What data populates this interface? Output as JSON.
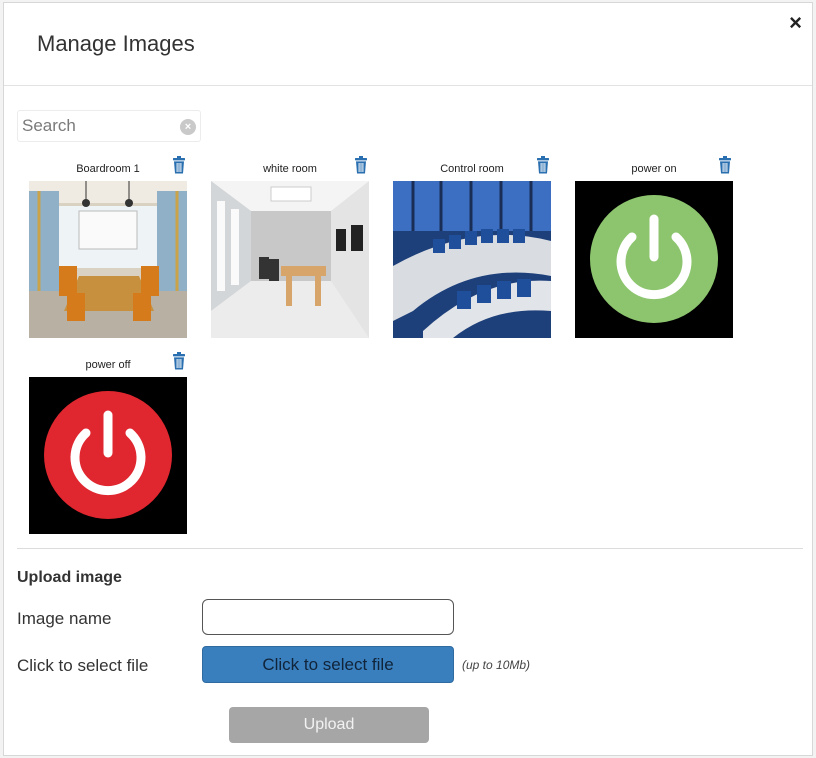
{
  "dialog": {
    "title": "Manage Images",
    "close_label": "×"
  },
  "search": {
    "placeholder": "Search",
    "value": ""
  },
  "images": [
    {
      "label": "Boardroom 1",
      "thumb": "boardroom-photo"
    },
    {
      "label": "white room",
      "thumb": "white-room-photo"
    },
    {
      "label": "Control room",
      "thumb": "control-room-photo"
    },
    {
      "label": "power on",
      "thumb": "power-on-icon",
      "color": "#8cc56e"
    },
    {
      "label": "power off",
      "thumb": "power-off-icon",
      "color": "#e0262f"
    }
  ],
  "upload": {
    "title": "Upload image",
    "name_label": "Image name",
    "name_value": "",
    "file_label": "Click to select file",
    "select_button": "Click to select file",
    "size_note": "(up to 10Mb)",
    "upload_button": "Upload"
  },
  "colors": {
    "accent_blue": "#3a7fbd",
    "trash_blue": "#2a6fb0",
    "upload_disabled": "#a6a6a6"
  }
}
